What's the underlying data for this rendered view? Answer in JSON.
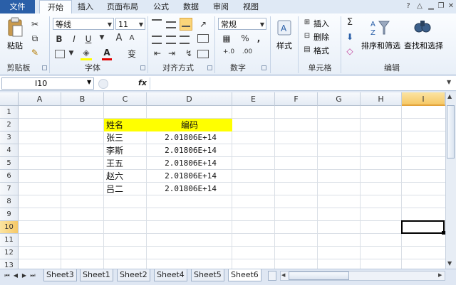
{
  "tabs": [
    "文件",
    "开始",
    "插入",
    "页面布局",
    "公式",
    "数据",
    "审阅",
    "视图"
  ],
  "active_tab": "开始",
  "ribbon": {
    "paste_label": "粘贴",
    "clipboard_label": "剪贴板",
    "font_name": "等线",
    "font_size": "11",
    "font_label": "字体",
    "align_label": "对齐方式",
    "number_format": "常规",
    "number_label": "数字",
    "style_label": "样式",
    "insert_label": "插入",
    "delete_label": "删除",
    "format_label": "格式",
    "cells_label": "单元格",
    "sort_label": "排序和筛选",
    "find_label": "查找和选择",
    "edit_label": "编辑",
    "percent_symbol": "%",
    "comma_symbol": ","
  },
  "formula_bar": {
    "cell_ref": "I10",
    "fx": "fx",
    "formula": ""
  },
  "columns": [
    "A",
    "B",
    "C",
    "D",
    "E",
    "F",
    "G",
    "H",
    "I"
  ],
  "selected_column": "I",
  "rows": [
    "1",
    "2",
    "3",
    "4",
    "5",
    "6",
    "7",
    "8",
    "9",
    "10",
    "11",
    "12",
    "13"
  ],
  "selected_row": "10",
  "cells": {
    "C2": "姓名",
    "D2": "编码",
    "C3": "张三",
    "D3": "2.01806E+14",
    "C4": "李斯",
    "D4": "2.01806E+14",
    "C5": "王五",
    "D5": "2.01806E+14",
    "C6": "赵六",
    "D6": "2.01806E+14",
    "C7": "吕二",
    "D7": "2.01806E+14"
  },
  "header_fill": "#ffff00",
  "sheets": [
    "Sheet3",
    "Sheet1",
    "Sheet2",
    "Sheet4",
    "Sheet5",
    "Sheet6"
  ],
  "active_sheet": "Sheet6",
  "icons": {
    "format_painter": "✎",
    "cut": "✂",
    "copy": "⧉",
    "bold": "B",
    "italic": "I",
    "underline": "U",
    "grow_font": "A",
    "shrink_font": "A",
    "font_color": "A",
    "fill_color": "◈",
    "sum": "Σ",
    "fill": "⬇",
    "clear": "◇",
    "find": "⌕"
  }
}
